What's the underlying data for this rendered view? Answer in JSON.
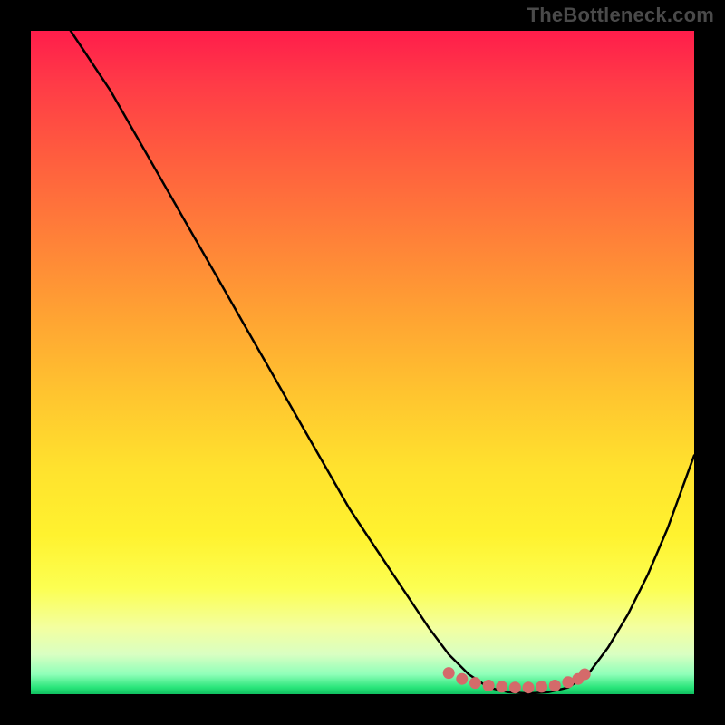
{
  "watermark": "TheBottleneck.com",
  "chart_data": {
    "type": "line",
    "title": "",
    "xlabel": "",
    "ylabel": "",
    "xlim": [
      0,
      100
    ],
    "ylim": [
      0,
      100
    ],
    "series": [
      {
        "name": "curve",
        "x": [
          0,
          4,
          8,
          12,
          16,
          20,
          24,
          28,
          32,
          36,
          40,
          44,
          48,
          52,
          56,
          60,
          63,
          66,
          69,
          72,
          75,
          78,
          81,
          84,
          87,
          90,
          93,
          96,
          100
        ],
        "values": [
          109,
          103,
          97,
          91,
          84,
          77,
          70,
          63,
          56,
          49,
          42,
          35,
          28,
          22,
          16,
          10,
          6,
          3,
          1,
          0.3,
          0.1,
          0.3,
          1,
          3,
          7,
          12,
          18,
          25,
          36
        ]
      },
      {
        "name": "highlight-dots",
        "x": [
          63,
          65,
          67,
          69,
          71,
          73,
          75,
          77,
          79,
          81,
          82.5,
          83.5
        ],
        "values": [
          3.2,
          2.3,
          1.7,
          1.3,
          1.1,
          1.0,
          1.0,
          1.1,
          1.3,
          1.8,
          2.3,
          3.0
        ]
      }
    ],
    "colors": {
      "curve": "#000000",
      "dots": "#d46a6a",
      "gradient_top": "#ff1d4b",
      "gradient_mid": "#ffe22e",
      "gradient_bottom": "#10c060"
    },
    "grid": false,
    "legend": false
  }
}
